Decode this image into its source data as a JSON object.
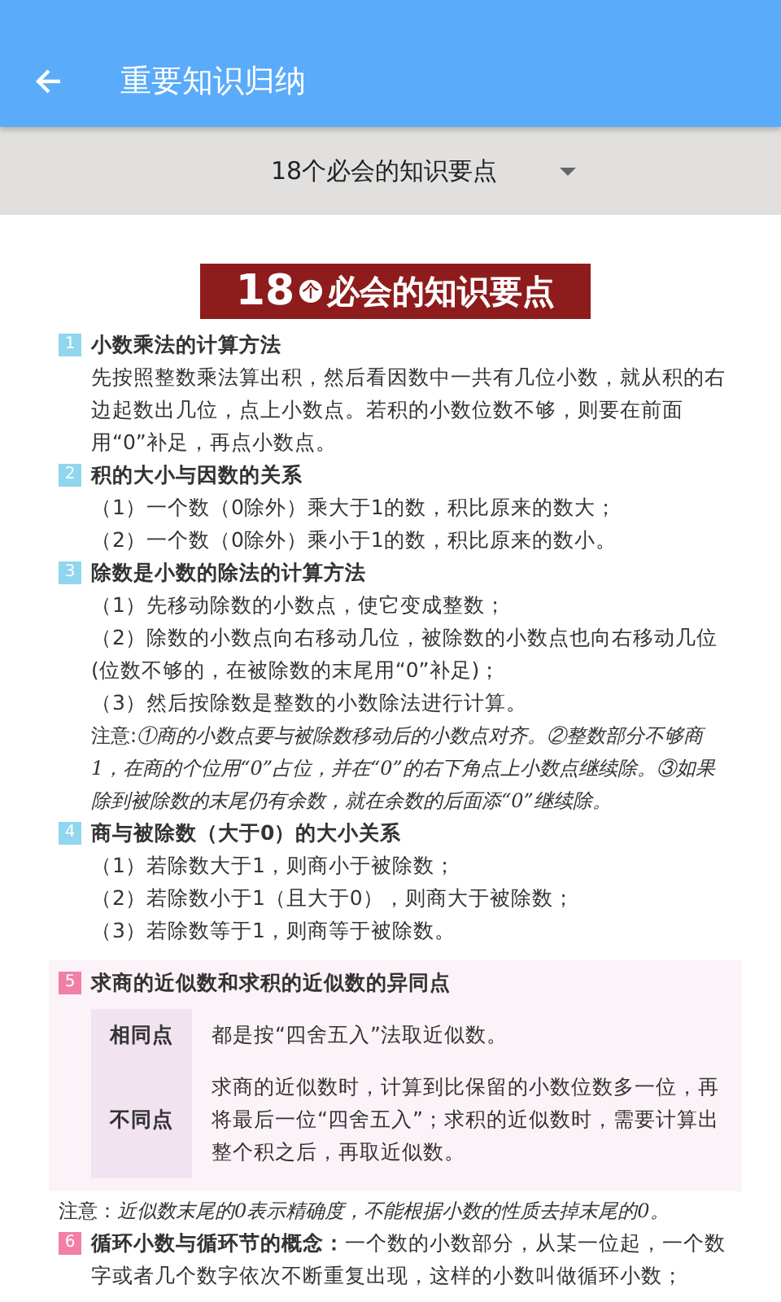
{
  "app_bar": {
    "title": "重要知识归纳"
  },
  "selector": {
    "label": "18个必会的知识要点"
  },
  "document": {
    "banner": {
      "number": "18",
      "counter": "个",
      "title": "必会的知识要点"
    },
    "sections": [
      {
        "number": "1",
        "kind": "text",
        "color": "#8fd6ee",
        "heading": "小数乘法的计算方法",
        "paragraphs": [
          "先按照整数乘法算出积，然后看因数中一共有几位小数，就从积的右边起数出几位，点上小数点。若积的小数位数不够，则要在前面用“0”补足，再点小数点。"
        ]
      },
      {
        "number": "2",
        "kind": "text",
        "color": "#8fd6ee",
        "heading": "积的大小与因数的关系",
        "paragraphs": [
          "（1）一个数（0除外）乘大于1的数，积比原来的数大；",
          "（2）一个数（0除外）乘小于1的数，积比原来的数小。"
        ]
      },
      {
        "number": "3",
        "kind": "text",
        "color": "#8fd6ee",
        "heading": "除数是小数的除法的计算方法",
        "paragraphs": [
          "（1）先移动除数的小数点，使它变成整数；",
          "（2）除数的小数点向右移动几位，被除数的小数点也向右移动几位(位数不够的，在被除数的末尾用“0”补足)；",
          "（3）然后按除数是整数的小数除法进行计算。"
        ],
        "note": {
          "label": "注意:",
          "text": "①商的小数点要与被除数移动后的小数点对齐。②整数部分不够商1，在商的个位用“0”占位，并在“0”的右下角点上小数点继续除。③如果除到被除数的末尾仍有余数，就在余数的后面添“0”继续除。"
        }
      },
      {
        "number": "4",
        "kind": "text",
        "color": "#8fd6ee",
        "heading": "商与被除数（大于0）的大小关系",
        "paragraphs": [
          "（1）若除数大于1，则商小于被除数；",
          "（2）若除数小于1（且大于0），则商大于被除数；",
          "（3）若除数等于1，则商等于被除数。"
        ]
      },
      {
        "number": "5",
        "kind": "table",
        "color": "#f27fa8",
        "heading": "求商的近似数和求积的近似数的异同点",
        "rows": [
          {
            "label": "相同点",
            "text": "都是按“四舍五入”法取近似数。"
          },
          {
            "label": "不同点",
            "text": "求商的近似数时，计算到比保留的小数位数多一位，再将最后一位“四舍五入”；求积的近似数时，需要计算出整个积之后，再取近似数。"
          }
        ],
        "note": {
          "label": "注意：",
          "text": "近似数末尾的0表示精确度，不能根据小数的性质去掉末尾的0。"
        }
      },
      {
        "number": "6",
        "kind": "inline",
        "color": "#f27fa8",
        "heading": "**循环小数与循环节的概念：**一个数的小数部分，从某一位起，一个数字或者几个数字依次不断重复出现，这样的小数叫做循环小数；"
      }
    ]
  }
}
